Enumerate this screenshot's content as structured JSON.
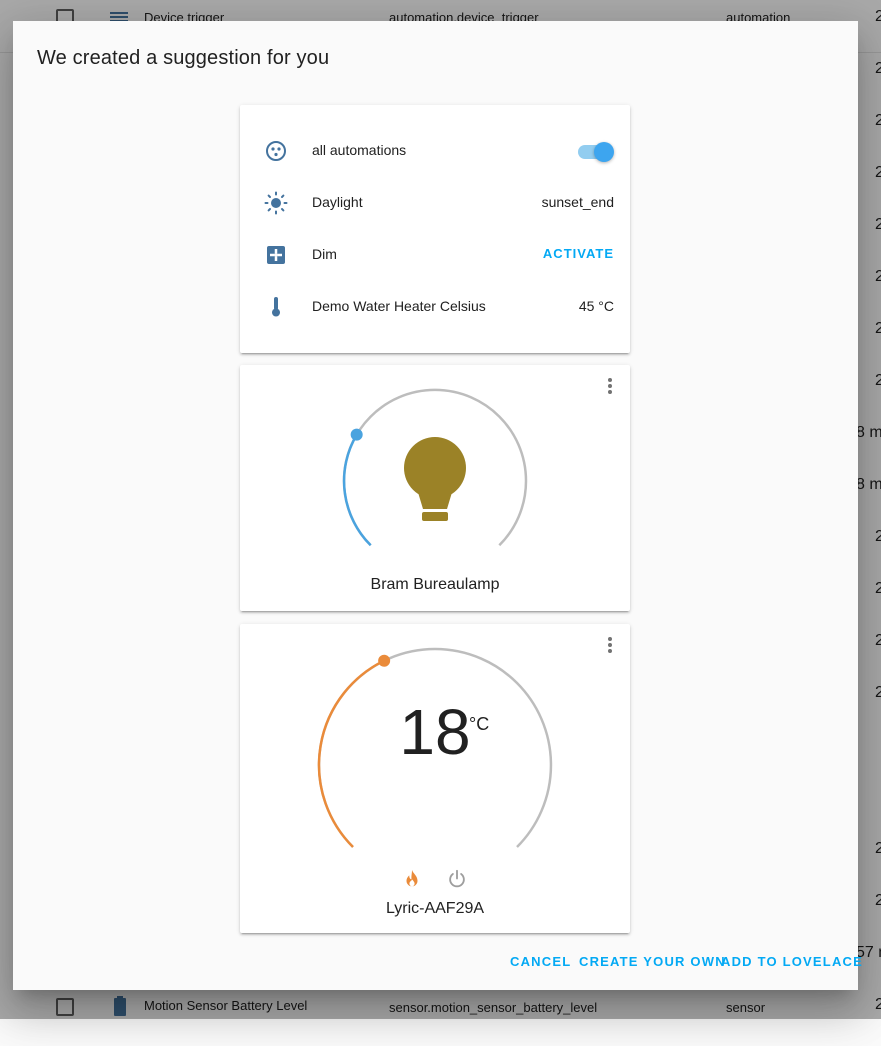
{
  "background": {
    "top_row": {
      "name": "Device trigger",
      "entity": "automation.device_trigger",
      "domain": "automation"
    },
    "bottom_row": {
      "name": "Motion Sensor Battery Level",
      "entity": "sensor.motion_sensor_battery_level",
      "domain": "sensor"
    },
    "right_edge": [
      "2",
      "2",
      "2",
      "2",
      "2",
      "2",
      "2",
      "2",
      "8 m",
      "8 m",
      "2",
      "2",
      "2",
      "2",
      "2",
      "2",
      "57 m",
      "2"
    ]
  },
  "dialog": {
    "title": "We created a suggestion for you",
    "entities_card": {
      "rows": [
        {
          "icon": "robot-icon",
          "name": "all automations",
          "control": "toggle",
          "toggle_on": true
        },
        {
          "icon": "sun-icon",
          "name": "Daylight",
          "state": "sunset_end"
        },
        {
          "icon": "scene-icon",
          "name": "Dim",
          "action": "ACTIVATE"
        },
        {
          "icon": "thermometer-icon",
          "name": "Demo Water Heater Celsius",
          "state": "45 °C"
        }
      ]
    },
    "light_card": {
      "name": "Bram Bureaulamp",
      "brightness_fraction": 0.28,
      "icon": "lightbulb-icon",
      "bulb_color": "#9b8227",
      "arc_color": "#4aa3df"
    },
    "thermostat_card": {
      "name": "Lyric-AAF29A",
      "temperature": "18",
      "unit": "°C",
      "modes": [
        "fire-icon",
        "power-icon"
      ],
      "active_mode_color": "#ea8b3a"
    },
    "actions": {
      "cancel": "CANCEL",
      "create_own": "CREATE YOUR OWN",
      "add": "ADD TO LOVELACE"
    }
  }
}
